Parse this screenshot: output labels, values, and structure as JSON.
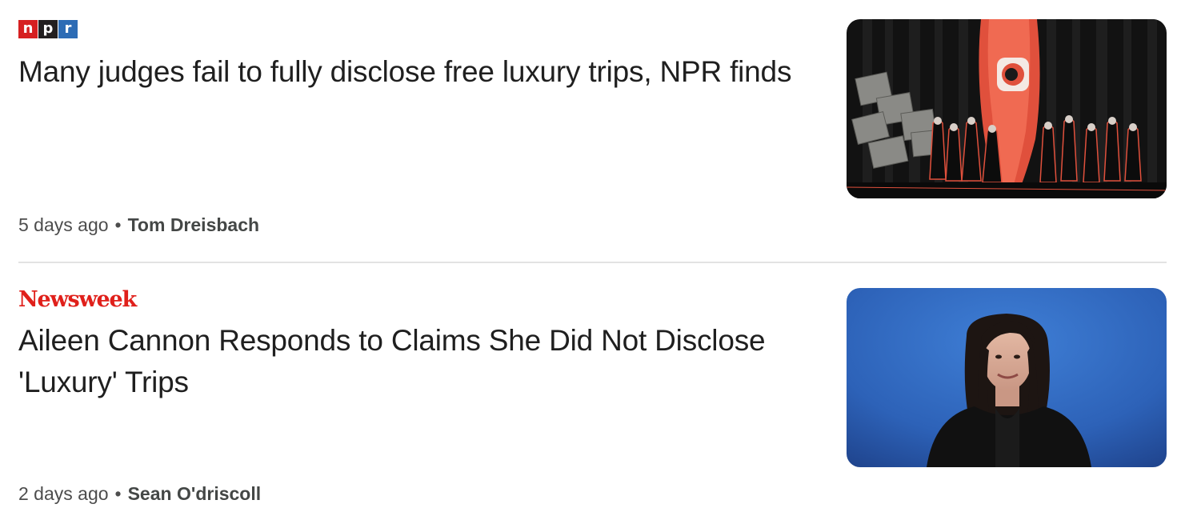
{
  "articles": [
    {
      "source": "npr",
      "logo_letters": [
        "n",
        "p",
        "r"
      ],
      "logo_colors": [
        "#d62021",
        "#231f20",
        "#2d6cb5"
      ],
      "headline": "Many judges fail to fully disclose free luxury trips, NPR finds",
      "age": "5 days ago",
      "separator": "•",
      "author": "Tom Dreisbach",
      "image": "illustration-judges-curtain-eye"
    },
    {
      "source": "Newsweek",
      "logo_text": "Newsweek",
      "logo_color": "#e0201b",
      "headline": "Aileen Cannon Responds to Claims She Did Not Disclose 'Luxury' Trips",
      "age": "2 days ago",
      "separator": "•",
      "author": "Sean O'driscoll",
      "image": "portrait-judge-blue-background"
    }
  ]
}
